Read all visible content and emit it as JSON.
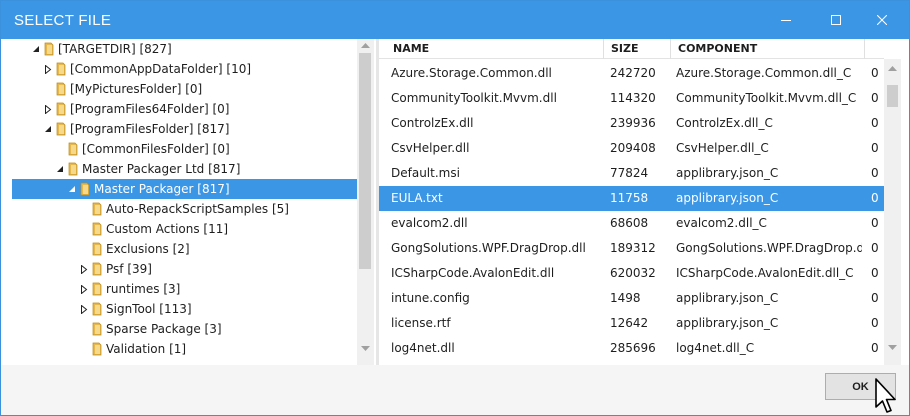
{
  "window": {
    "title": "SELECT FILE"
  },
  "titlebar_icons": {
    "minimize": "minimize-icon",
    "maximize": "maximize-icon",
    "close": "close-icon"
  },
  "tree": [
    {
      "label": "[TARGETDIR] [827]",
      "expander": "expanded"
    },
    {
      "label": "[CommonAppDataFolder] [10]",
      "expander": "collapsed"
    },
    {
      "label": "[MyPicturesFolder] [0]",
      "expander": "none"
    },
    {
      "label": "[ProgramFiles64Folder] [0]",
      "expander": "collapsed"
    },
    {
      "label": "[ProgramFilesFolder] [817]",
      "expander": "expanded"
    },
    {
      "label": "[CommonFilesFolder] [0]",
      "expander": "none"
    },
    {
      "label": "Master Packager Ltd [817]",
      "expander": "expanded"
    },
    {
      "label": "Master Packager [817]",
      "expander": "expanded",
      "selected": true
    },
    {
      "label": "Auto-RepackScriptSamples [5]",
      "expander": "none"
    },
    {
      "label": "Custom Actions [11]",
      "expander": "none"
    },
    {
      "label": "Exclusions [2]",
      "expander": "none"
    },
    {
      "label": "Psf [39]",
      "expander": "collapsed"
    },
    {
      "label": "runtimes [3]",
      "expander": "collapsed"
    },
    {
      "label": "SignTool [113]",
      "expander": "collapsed"
    },
    {
      "label": "Sparse Package [3]",
      "expander": "none"
    },
    {
      "label": "Validation [1]",
      "expander": "none"
    }
  ],
  "grid": {
    "columns": [
      "NAME",
      "SIZE",
      "COMPONENT"
    ],
    "rows": [
      {
        "name": "Azure.Storage.Common.dll",
        "size": "242720",
        "component": "Azure.Storage.Common.dll_C",
        "extra": "0"
      },
      {
        "name": "CommunityToolkit.Mvvm.dll",
        "size": "114320",
        "component": "CommunityToolkit.Mvvm.dll_C",
        "extra": "0"
      },
      {
        "name": "ControlzEx.dll",
        "size": "239936",
        "component": "ControlzEx.dll_C",
        "extra": "0"
      },
      {
        "name": "CsvHelper.dll",
        "size": "209408",
        "component": "CsvHelper.dll_C",
        "extra": "0"
      },
      {
        "name": "Default.msi",
        "size": "77824",
        "component": "applibrary.json_C",
        "extra": "0"
      },
      {
        "name": "EULA.txt",
        "size": "11758",
        "component": "applibrary.json_C",
        "extra": "0",
        "selected": true
      },
      {
        "name": "evalcom2.dll",
        "size": "68608",
        "component": "evalcom2.dll_C",
        "extra": "0"
      },
      {
        "name": "GongSolutions.WPF.DragDrop.dll",
        "size": "189312",
        "component": "GongSolutions.WPF.DragDrop.dll_C",
        "extra": "0"
      },
      {
        "name": "ICSharpCode.AvalonEdit.dll",
        "size": "620032",
        "component": "ICSharpCode.AvalonEdit.dll_C",
        "extra": "0"
      },
      {
        "name": "intune.config",
        "size": "1498",
        "component": "applibrary.json_C",
        "extra": "0"
      },
      {
        "name": "license.rtf",
        "size": "12642",
        "component": "applibrary.json_C",
        "extra": "0"
      },
      {
        "name": "log4net.dll",
        "size": "285696",
        "component": "log4net.dll_C",
        "extra": "0"
      }
    ]
  },
  "footer": {
    "ok_label": "OK"
  },
  "colors": {
    "accent": "#3c96e6",
    "folder": "#e8b84a"
  }
}
